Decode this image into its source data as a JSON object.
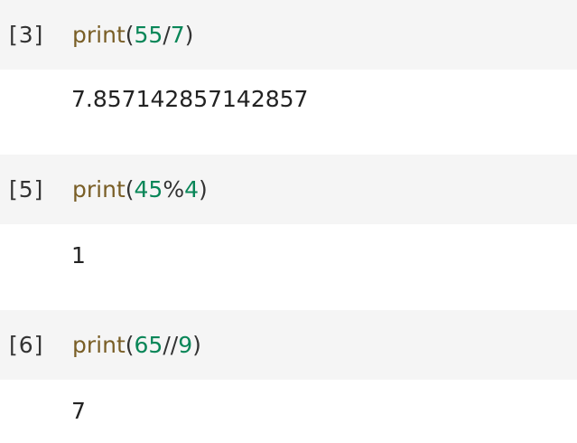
{
  "cells": [
    {
      "prompt": "[3]",
      "code": {
        "func": "print",
        "open": "(",
        "a": "55",
        "op": "/",
        "b": "7",
        "close": ")"
      },
      "output": "7.857142857142857"
    },
    {
      "prompt": "[5]",
      "code": {
        "func": "print",
        "open": "(",
        "a": "45",
        "op": "%",
        "b": "4",
        "close": ")"
      },
      "output": "1"
    },
    {
      "prompt": "[6]",
      "code": {
        "func": "print",
        "open": "(",
        "a": "65",
        "op": "//",
        "b": "9",
        "close": ")"
      },
      "output": "7"
    }
  ],
  "colors": {
    "input_bg": "#f5f5f5",
    "function": "#795e26",
    "number": "#098658",
    "text": "#222222"
  }
}
